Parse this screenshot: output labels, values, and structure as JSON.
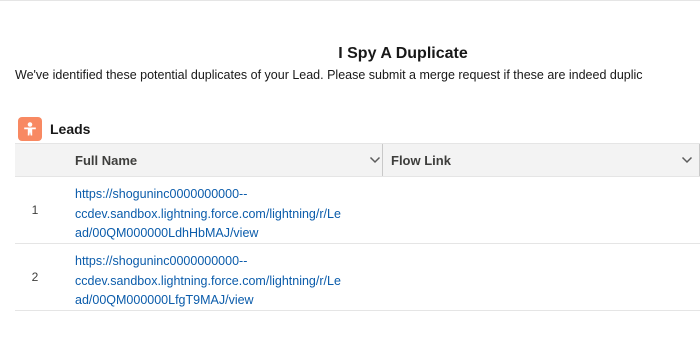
{
  "page": {
    "title": "I Spy A Duplicate",
    "subtitle": "We've identified these potential duplicates of your Lead. Please submit a merge request if these are indeed duplic"
  },
  "section": {
    "title": "Leads",
    "icon": "lead-person-icon",
    "icon_color": "#f88962"
  },
  "table": {
    "columns": [
      "Full Name",
      "Flow Link"
    ],
    "rows": [
      {
        "num": "1",
        "full_name": {
          "line1": "https://shoguninc0000000000--",
          "line2": "ccdev.sandbox.lightning.force.com/lightning/r/Le",
          "line3": "ad/00QM000000LdhHbMAJ/view"
        },
        "flow_link": ""
      },
      {
        "num": "2",
        "full_name": {
          "line1": "https://shoguninc0000000000--",
          "line2": "ccdev.sandbox.lightning.force.com/lightning/r/Le",
          "line3": "ad/00QM000000LfgT9MAJ/view"
        },
        "flow_link": ""
      }
    ]
  },
  "colors": {
    "link": "#0b5cab",
    "header_bg": "#f3f3f3"
  }
}
